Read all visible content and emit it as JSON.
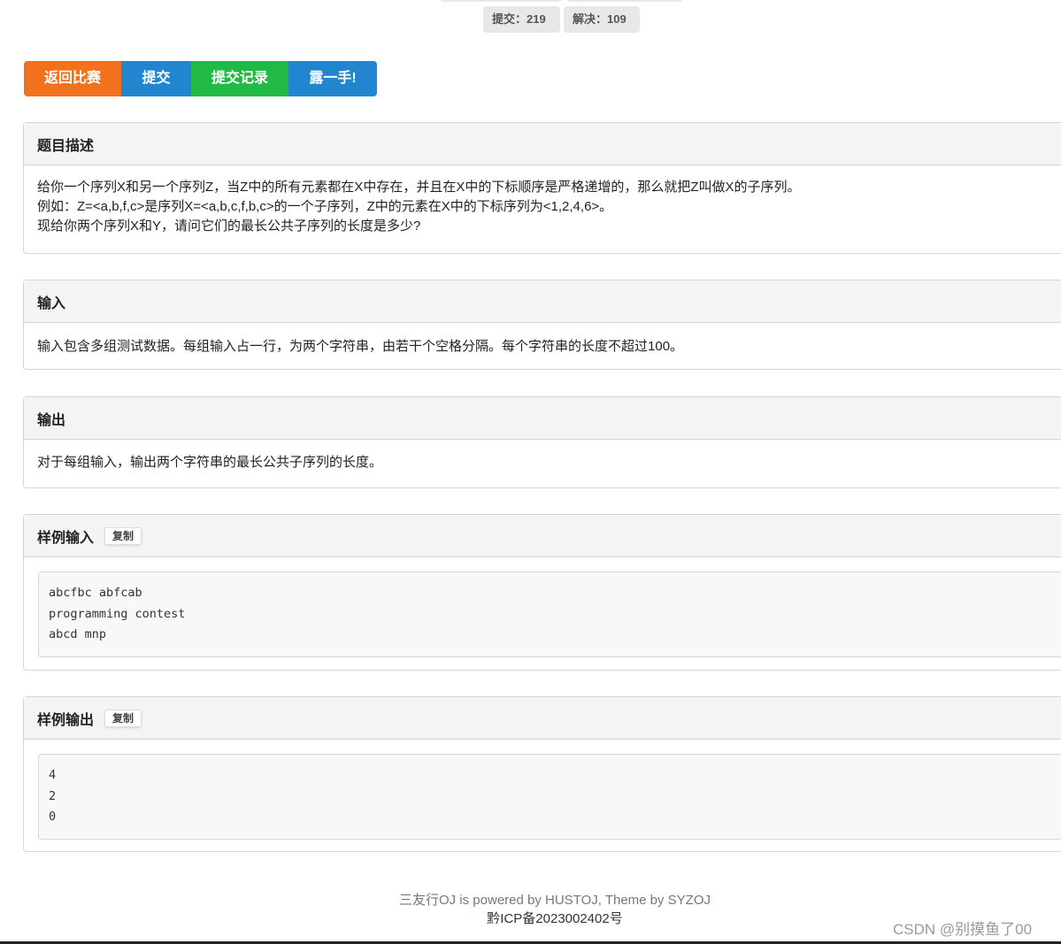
{
  "stats": {
    "submit": "提交：219",
    "solved": "解决：109"
  },
  "buttons": {
    "back": "返回比赛",
    "submit": "提交",
    "records": "提交记录",
    "show": "露一手!"
  },
  "description": {
    "title": "题目描述",
    "lines": [
      "给你一个序列X和另一个序列Z，当Z中的所有元素都在X中存在，并且在X中的下标顺序是严格递增的，那么就把Z叫做X的子序列。",
      "例如：Z=<a,b,f,c>是序列X=<a,b,c,f,b,c>的一个子序列，Z中的元素在X中的下标序列为<1,2,4,6>。",
      "现给你两个序列X和Y，请问它们的最长公共子序列的长度是多少?"
    ]
  },
  "input": {
    "title": "输入",
    "text": "输入包含多组测试数据。每组输入占一行，为两个字符串，由若干个空格分隔。每个字符串的长度不超过100。"
  },
  "output": {
    "title": "输出",
    "text": "对于每组输入，输出两个字符串的最长公共子序列的长度。"
  },
  "sample_input": {
    "title": "样例输入",
    "copy": "复制",
    "lines": [
      "abcfbc abfcab",
      "programming contest",
      "abcd mnp"
    ]
  },
  "sample_output": {
    "title": "样例输出",
    "copy": "复制",
    "lines": [
      "4",
      "2",
      "0"
    ]
  },
  "footer": {
    "line1": "三友行OJ is powered by HUSTOJ, Theme by SYZOJ",
    "line2": "黔ICP备2023002402号"
  },
  "watermark": "CSDN @别摸鱼了00",
  "colors": {
    "orange": "#f2711c",
    "blue": "#2185d0",
    "green": "#21ba45"
  }
}
